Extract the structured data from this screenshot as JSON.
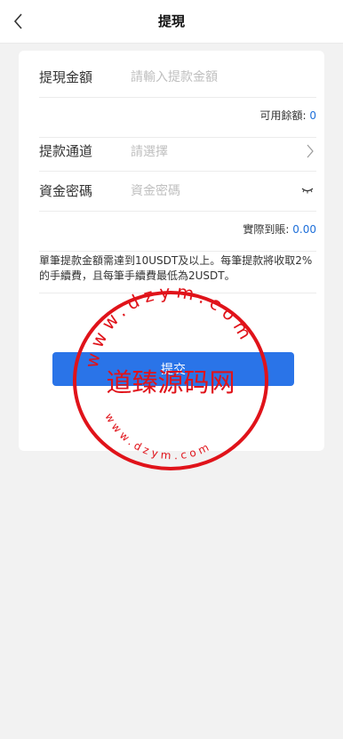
{
  "header": {
    "title": "提現"
  },
  "form": {
    "amount": {
      "label": "提現金額",
      "placeholder": "請輸入提款金額"
    },
    "balance": {
      "label": "可用餘額:",
      "value": "0"
    },
    "channel": {
      "label": "提款通道",
      "placeholder": "請選擇"
    },
    "password": {
      "label": "資金密碼",
      "placeholder": "資金密碼"
    },
    "received": {
      "label": "實際到賬:",
      "value": "0.00"
    },
    "notice": "單筆提款金額需達到10USDT及以上。每筆提款將收取2%的手續費，且每筆手續費最低為2USDT。",
    "submit_label": "提交"
  },
  "watermark": {
    "center_text": "道臻源码网",
    "ring_top": "www.dzym.com",
    "ring_bottom": "www.dzym.com",
    "color": "#e0131a"
  },
  "colors": {
    "accent": "#2a74e8",
    "value_blue": "#1e6fd9",
    "background": "#f2f2f2"
  },
  "icons": {
    "back": "chevron-left-icon",
    "select": "chevron-right-icon",
    "password_toggle": "eye-closed-icon"
  }
}
